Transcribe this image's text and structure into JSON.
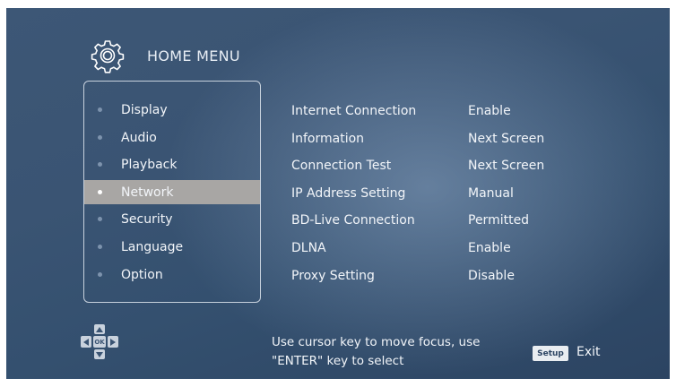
{
  "header": {
    "title": "HOME MENU",
    "icon": "gear-icon"
  },
  "menu": {
    "items": [
      {
        "label": "Display",
        "selected": false
      },
      {
        "label": "Audio",
        "selected": false
      },
      {
        "label": "Playback",
        "selected": false
      },
      {
        "label": "Network",
        "selected": true
      },
      {
        "label": "Security",
        "selected": false
      },
      {
        "label": "Language",
        "selected": false
      },
      {
        "label": "Option",
        "selected": false
      }
    ]
  },
  "settings": {
    "rows": [
      {
        "name": "Internet Connection",
        "value": "Enable"
      },
      {
        "name": "Information",
        "value": "Next Screen"
      },
      {
        "name": "Connection Test",
        "value": "Next Screen"
      },
      {
        "name": "IP Address Setting",
        "value": "Manual"
      },
      {
        "name": "BD-Live Connection",
        "value": "Permitted"
      },
      {
        "name": "DLNA",
        "value": "Enable"
      },
      {
        "name": "Proxy Setting",
        "value": "Disable"
      }
    ]
  },
  "footer": {
    "dpad_ok": "OK",
    "hint_line1": "Use cursor key to move focus, use",
    "hint_line2": "\"ENTER\" key to select",
    "setup_key": "Setup",
    "exit_label": "Exit"
  },
  "colors": {
    "background": "#3a5473",
    "selected_row": "#a8a6a4",
    "text": "#f2f5f9"
  }
}
